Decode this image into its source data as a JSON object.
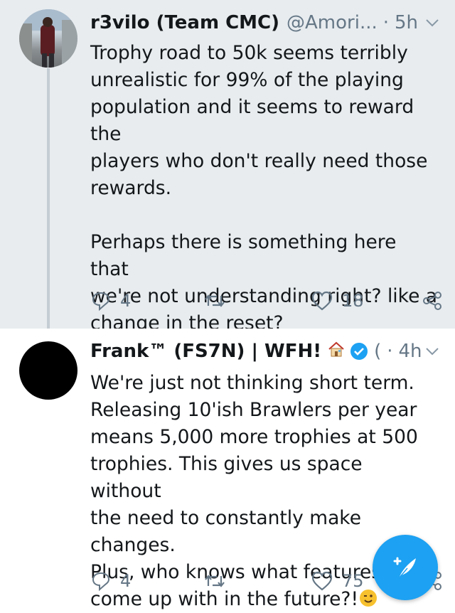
{
  "tweets": [
    {
      "name": "r3vilo (Team CMC)",
      "handle": "@Amori...",
      "dot": "·",
      "time": "5h",
      "body": "Trophy road to 50k seems terribly\nunrealistic for 99% of the playing\npopulation and it seems to reward the\nplayers who don't really need those\nrewards.\n\nPerhaps there is something here that\nwe're not understanding right? like a\nchange in the reset?",
      "replies": "4",
      "retweets": "",
      "likes": "18"
    },
    {
      "name": "Frank™ (FS7N) | WFH!",
      "handle": "(",
      "dot": "·",
      "time": "4h",
      "body": "We're just not thinking short term.\nReleasing 10'ish Brawlers per year\nmeans 5,000 more trophies at 500\ntrophies. This gives us space without\nthe need to constantly make changes.\nPlus, who knows what features we'll\ncome up with in the future?!",
      "replies": "4",
      "retweets": "",
      "likes": "75"
    }
  ],
  "icons": {
    "reply": "reply-icon",
    "retweet": "retweet-icon",
    "like": "heart-icon",
    "share": "share-icon",
    "compose": "compose-tweet-icon",
    "verified": "verified-badge-icon",
    "house": "house-emoji-icon",
    "wink": "wink-emoji-icon"
  },
  "colors": {
    "accent": "#1da1f2",
    "muted": "#657786",
    "thread_bg": "#e8ecef"
  }
}
